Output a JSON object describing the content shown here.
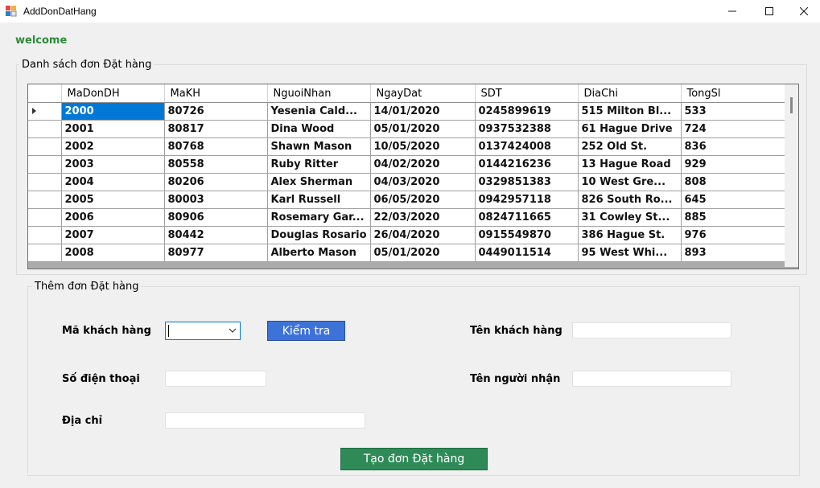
{
  "window": {
    "title": "AddDonDatHang"
  },
  "welcome": "welcome",
  "list_group": {
    "title": "Danh sách đơn Đặt hàng"
  },
  "grid": {
    "columns": [
      "MaDonDH",
      "MaKH",
      "NguoiNhan",
      "NgayDat",
      "SDT",
      "DiaChi",
      "TongSl"
    ],
    "rows": [
      [
        "2000",
        "80726",
        "Yesenia Cald...",
        "14/01/2020",
        "0245899619",
        "515 Milton Bl...",
        "533"
      ],
      [
        "2001",
        "80817",
        "Dina Wood",
        "05/01/2020",
        "0937532388",
        "61 Hague Drive",
        "724"
      ],
      [
        "2002",
        "80768",
        "Shawn Mason",
        "10/05/2020",
        "0137424008",
        "252 Old St.",
        "836"
      ],
      [
        "2003",
        "80558",
        "Ruby Ritter",
        "04/02/2020",
        "0144216236",
        "13 Hague Road",
        "929"
      ],
      [
        "2004",
        "80206",
        "Alex Sherman",
        "04/03/2020",
        "0329851383",
        "10 West Gre...",
        "808"
      ],
      [
        "2005",
        "80003",
        "Karl Russell",
        "06/05/2020",
        "0942957118",
        "826 South Ro...",
        "645"
      ],
      [
        "2006",
        "80906",
        "Rosemary Gar...",
        "22/03/2020",
        "0824711665",
        "31 Cowley St...",
        "885"
      ],
      [
        "2007",
        "80442",
        "Douglas Rosario",
        "26/04/2020",
        "0915549870",
        "386 Hague St.",
        "976"
      ],
      [
        "2008",
        "80977",
        "Alberto Mason",
        "05/01/2020",
        "0449011514",
        "95 West Whi...",
        "893"
      ]
    ]
  },
  "add_group": {
    "title": "Thêm đơn Đặt hàng",
    "ma_khach_hang_label": "Mã khách hàng",
    "kiem_tra_button": "Kiểm tra",
    "ten_khach_hang_label": "Tên khách hàng",
    "so_dien_thoai_label": "Số điện thoại",
    "ten_nguoi_nhan_label": "Tên người nhận",
    "dia_chi_label": "Địa chỉ",
    "ma_khach_hang_value": "",
    "ten_khach_hang_value": "",
    "so_dien_thoai_value": "",
    "ten_nguoi_nhan_value": "",
    "dia_chi_value": "",
    "tao_button": "Tạo đơn Đặt hàng"
  },
  "colors": {
    "accent_green": "#2e8b57",
    "button_blue": "#3d73d9",
    "selection": "#0078d7"
  }
}
